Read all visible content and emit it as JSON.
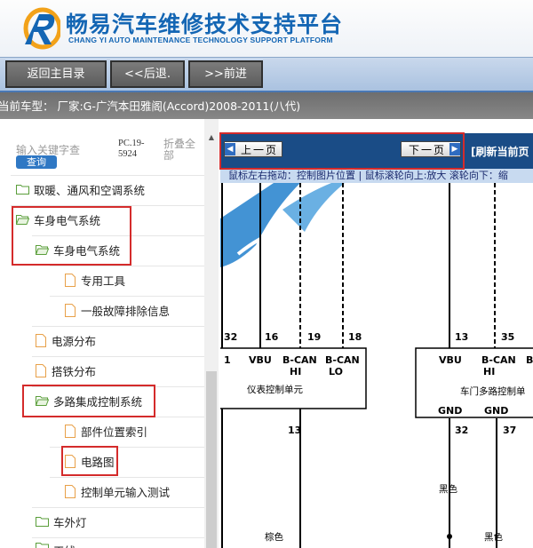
{
  "header": {
    "title": "畅易汽车维修技术支持平台",
    "subtitle": "CHANG YI AUTO MAINTENANCE TECHNOLOGY SUPPORT PLATFORM",
    "logo_icon": "cy-logo-icon"
  },
  "nav": {
    "home": "返回主目录",
    "back": "<<后退.",
    "forward": ">>前进"
  },
  "vehicle": {
    "label": "当前车型： 厂家:G-广汽本田雅阁(Accord)2008-2011(八代)"
  },
  "sidebar": {
    "search_placeholder": "输入关键字查",
    "search_button": "查询",
    "pc_code": "PC.19-5924",
    "collapse_all": "折叠全部",
    "items": [
      {
        "label": "取暖、通风和空调系统",
        "icon": "folder-icon"
      },
      {
        "label": "车身电气系统",
        "icon": "folder-open-icon"
      },
      {
        "label": "车身电气系统",
        "icon": "folder-open-icon"
      },
      {
        "label": "专用工具",
        "icon": "document-icon"
      },
      {
        "label": "一般故障排除信息",
        "icon": "document-icon"
      },
      {
        "label": "电源分布",
        "icon": "document-icon"
      },
      {
        "label": "搭铁分布",
        "icon": "document-icon"
      },
      {
        "label": "多路集成控制系统",
        "icon": "folder-open-icon"
      },
      {
        "label": "部件位置索引",
        "icon": "document-icon"
      },
      {
        "label": "电路图",
        "icon": "document-icon"
      },
      {
        "label": "控制单元输入测试",
        "icon": "document-icon"
      },
      {
        "label": "车外灯",
        "icon": "folder-icon"
      },
      {
        "label": "天线",
        "icon": "folder-icon"
      }
    ]
  },
  "viewer": {
    "prev_page": "上一页",
    "next_page": "下一页",
    "refresh": "[刷新当前页",
    "hint": "鼠标左右拖动：控制图片位置 | 鼠标滚轮向上:放大  滚轮向下：缩"
  },
  "diagram": {
    "left_unit": {
      "name": "仪表控制单元",
      "pins": [
        "32",
        "16",
        "19",
        "18"
      ],
      "pin_labels": [
        "1",
        "VBU",
        "B-CAN",
        "HI",
        "B-CAN",
        "LO"
      ],
      "bottom_pin": "13"
    },
    "right_unit": {
      "name": "车门多路控制单",
      "pins": [
        "13",
        "35"
      ],
      "pin_labels": [
        "VBU",
        "B-CAN",
        "HI",
        "B"
      ],
      "gnd_labels": [
        "GND",
        "GND"
      ],
      "bottom_pins": [
        "32",
        "37"
      ]
    },
    "wire_colors": [
      "棕色",
      "黑色",
      "黑色"
    ]
  },
  "colors": {
    "brand_blue": "#1466b4",
    "nav_dark": "#1a4c86",
    "highlight_red": "#d42b2b"
  }
}
